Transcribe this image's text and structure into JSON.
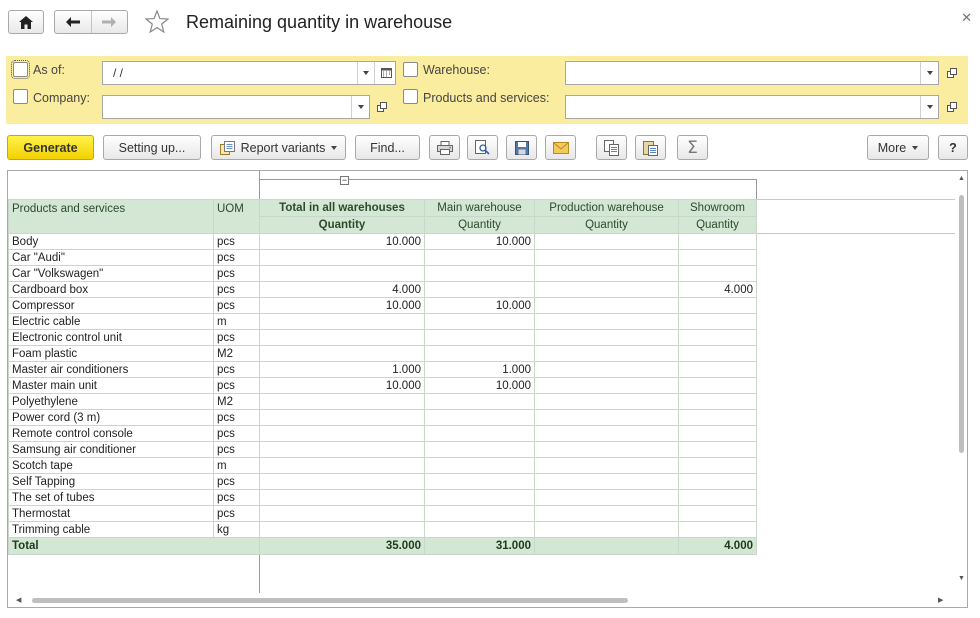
{
  "window": {
    "title": "Remaining quantity in warehouse"
  },
  "filters": {
    "as_of": {
      "label": "As of:",
      "value": " /  /"
    },
    "company": {
      "label": "Company:",
      "value": ""
    },
    "warehouse": {
      "label": "Warehouse:",
      "value": ""
    },
    "products": {
      "label": "Products and services:",
      "value": ""
    }
  },
  "toolbar": {
    "generate": "Generate",
    "setting_up": "Setting up...",
    "report_variants": "Report variants",
    "find": "Find...",
    "more": "More",
    "help": "?",
    "sum_symbol": "Σ"
  },
  "report": {
    "headers": {
      "product": "Products and services",
      "uom": "UOM",
      "total_all": "Total in all warehouses",
      "main": "Main warehouse",
      "production": "Production warehouse",
      "showroom": "Showroom",
      "quantity": "Quantity"
    },
    "rows": [
      {
        "product": "Body",
        "uom": "pcs",
        "total": "10.000",
        "main": "10.000",
        "production": "",
        "showroom": ""
      },
      {
        "product": "Car \"Audi\"",
        "uom": "pcs",
        "total": "",
        "main": "",
        "production": "",
        "showroom": ""
      },
      {
        "product": "Car \"Volkswagen\"",
        "uom": "pcs",
        "total": "",
        "main": "",
        "production": "",
        "showroom": ""
      },
      {
        "product": "Cardboard box",
        "uom": "pcs",
        "total": "4.000",
        "main": "",
        "production": "",
        "showroom": "4.000"
      },
      {
        "product": "Compressor",
        "uom": "pcs",
        "total": "10.000",
        "main": "10.000",
        "production": "",
        "showroom": ""
      },
      {
        "product": "Electric cable",
        "uom": "m",
        "total": "",
        "main": "",
        "production": "",
        "showroom": ""
      },
      {
        "product": "Electronic control unit",
        "uom": "pcs",
        "total": "",
        "main": "",
        "production": "",
        "showroom": ""
      },
      {
        "product": "Foam plastic",
        "uom": "M2",
        "total": "",
        "main": "",
        "production": "",
        "showroom": ""
      },
      {
        "product": "Master air conditioners",
        "uom": "pcs",
        "total": "1.000",
        "main": "1.000",
        "production": "",
        "showroom": ""
      },
      {
        "product": "Master main unit",
        "uom": "pcs",
        "total": "10.000",
        "main": "10.000",
        "production": "",
        "showroom": ""
      },
      {
        "product": "Polyethylene",
        "uom": "M2",
        "total": "",
        "main": "",
        "production": "",
        "showroom": ""
      },
      {
        "product": "Power cord (3 m)",
        "uom": "pcs",
        "total": "",
        "main": "",
        "production": "",
        "showroom": ""
      },
      {
        "product": "Remote control console",
        "uom": "pcs",
        "total": "",
        "main": "",
        "production": "",
        "showroom": ""
      },
      {
        "product": "Samsung air conditioner",
        "uom": "pcs",
        "total": "",
        "main": "",
        "production": "",
        "showroom": ""
      },
      {
        "product": "Scotch tape",
        "uom": "m",
        "total": "",
        "main": "",
        "production": "",
        "showroom": ""
      },
      {
        "product": "Self Tapping",
        "uom": "pcs",
        "total": "",
        "main": "",
        "production": "",
        "showroom": ""
      },
      {
        "product": "The set of tubes",
        "uom": "pcs",
        "total": "",
        "main": "",
        "production": "",
        "showroom": ""
      },
      {
        "product": "Thermostat",
        "uom": "pcs",
        "total": "",
        "main": "",
        "production": "",
        "showroom": ""
      },
      {
        "product": "Trimming cable",
        "uom": "kg",
        "total": "",
        "main": "",
        "production": "",
        "showroom": ""
      }
    ],
    "total_row": {
      "label": "Total",
      "total": "35.000",
      "main": "31.000",
      "production": "",
      "showroom": "4.000"
    }
  },
  "colors": {
    "filter_bg": "#fbeda0",
    "generate_bg": "#f3d100",
    "table_header_bg": "#d4e6d4"
  },
  "icons": [
    "home-icon",
    "back-arrow-icon",
    "forward-arrow-icon",
    "star-icon",
    "close-icon",
    "calendar-icon",
    "open-icon",
    "report-variants-icon",
    "print-icon",
    "preview-icon",
    "save-icon",
    "mail-icon",
    "copy-icon",
    "paste-icon",
    "sum-icon"
  ]
}
